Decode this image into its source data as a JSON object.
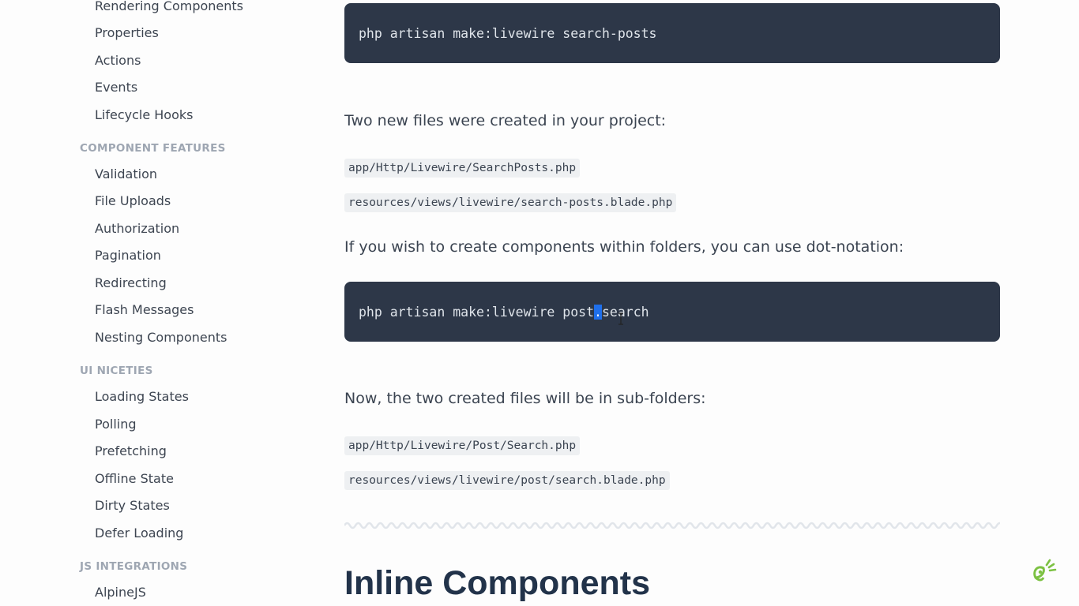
{
  "sidebar": {
    "items_top": [
      "Rendering Components",
      "Properties",
      "Actions",
      "Events",
      "Lifecycle Hooks"
    ],
    "section_component_features": "COMPONENT FEATURES",
    "items_features": [
      "Validation",
      "File Uploads",
      "Authorization",
      "Pagination",
      "Redirecting",
      "Flash Messages",
      "Nesting Components"
    ],
    "section_ui_niceties": "UI NICETIES",
    "items_niceties": [
      "Loading States",
      "Polling",
      "Prefetching",
      "Offline State",
      "Dirty States",
      "Defer Loading"
    ],
    "section_js_integrations": "JS INTEGRATIONS",
    "items_js": [
      "AlpineJS"
    ]
  },
  "main": {
    "code1": "php artisan make:livewire search-posts",
    "para1": "Two new files were created in your project:",
    "file1": "app/Http/Livewire/SearchPosts.php",
    "file2": "resources/views/livewire/search-posts.blade.php",
    "para2": "If you wish to create components within folders, you can use dot-notation:",
    "code2_before": "php artisan make:livewire post",
    "code2_selected": ".",
    "code2_after": "search",
    "para3": "Now, the two created files will be in sub-folders:",
    "file3": "app/Http/Livewire/Post/Search.php",
    "file4": "resources/views/livewire/post/search.blade.php",
    "heading": "Inline Components"
  },
  "icons": {
    "logo": "sprout-logo-icon",
    "cursor": "text-cursor-icon"
  },
  "colors": {
    "code_bg": "#2d3748",
    "heading": "#22334a",
    "selection": "#1f6feb",
    "logo_green": "#7cc142"
  }
}
